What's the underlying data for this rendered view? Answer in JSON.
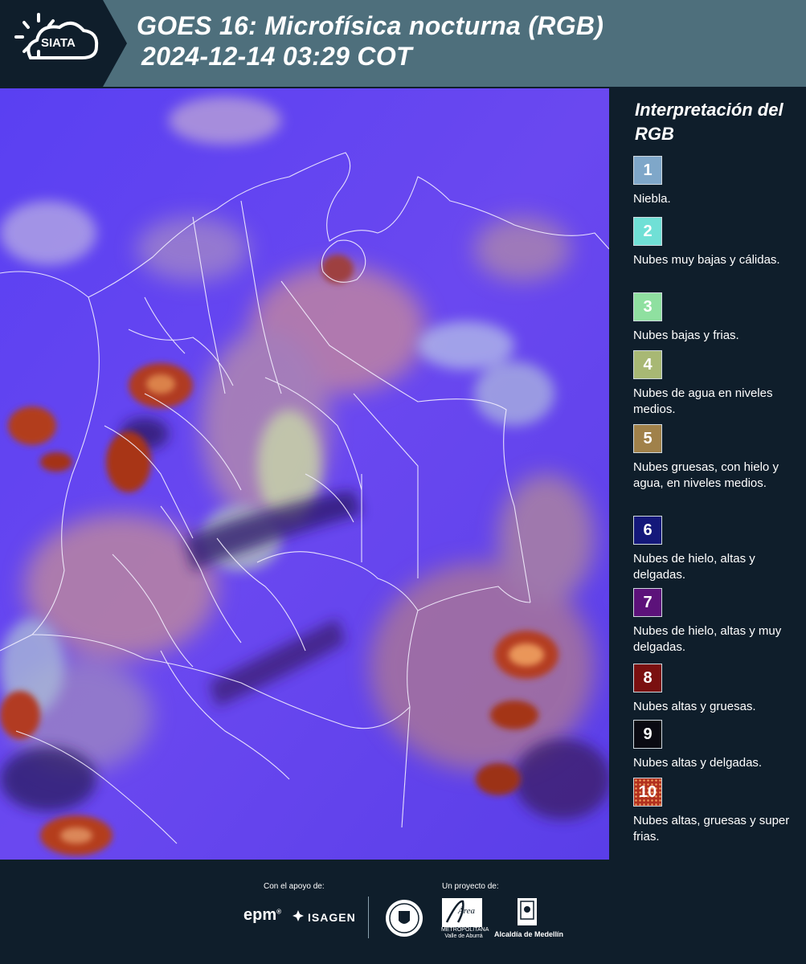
{
  "header": {
    "logo_text": "SIATA",
    "title_line1": "GOES 16: Microfísica nocturna (RGB)",
    "title_line2": "2024-12-14 03:29 COT"
  },
  "map": {
    "icon": "satellite-rgb-map"
  },
  "legend": {
    "title": "Interpretación del RGB",
    "items": [
      {
        "num": "1",
        "color": "#7fa7c9",
        "text": "Niebla."
      },
      {
        "num": "2",
        "color": "#70e0d6",
        "text": "Nubes muy bajas y cálidas."
      },
      {
        "num": "3",
        "color": "#8fe0a0",
        "text": "Nubes bajas y frias."
      },
      {
        "num": "4",
        "color": "#a8b874",
        "text": "Nubes de agua en niveles medios."
      },
      {
        "num": "5",
        "color": "#a0814a",
        "text": "Nubes gruesas, con hielo y agua, en niveles medios."
      },
      {
        "num": "6",
        "color": "#14187a",
        "text": "Nubes de hielo, altas y delgadas."
      },
      {
        "num": "7",
        "color": "#5c127a",
        "text": "Nubes de hielo, altas y muy delgadas."
      },
      {
        "num": "8",
        "color": "#7a1010",
        "text": "Nubes altas y gruesas."
      },
      {
        "num": "9",
        "color": "#0a0a12",
        "text": "Nubes altas y delgadas."
      },
      {
        "num": "10",
        "color": "#b2301e",
        "text": "Nubes altas, gruesas y super frias."
      }
    ]
  },
  "footer": {
    "support_label": "Con el apoyo de:",
    "project_label": "Un proyecto de:",
    "epm": "epm",
    "isagen": "ISAGEN",
    "metro_top": "Área",
    "metro_bottom": "METROPOLITANA Valle de Aburrá",
    "alcaldia": "Alcaldía de Medellín"
  },
  "colors": {
    "header_bg": "#4e6f7c",
    "page_bg": "#0f1e2b",
    "map_base": "#5b3ff0"
  }
}
